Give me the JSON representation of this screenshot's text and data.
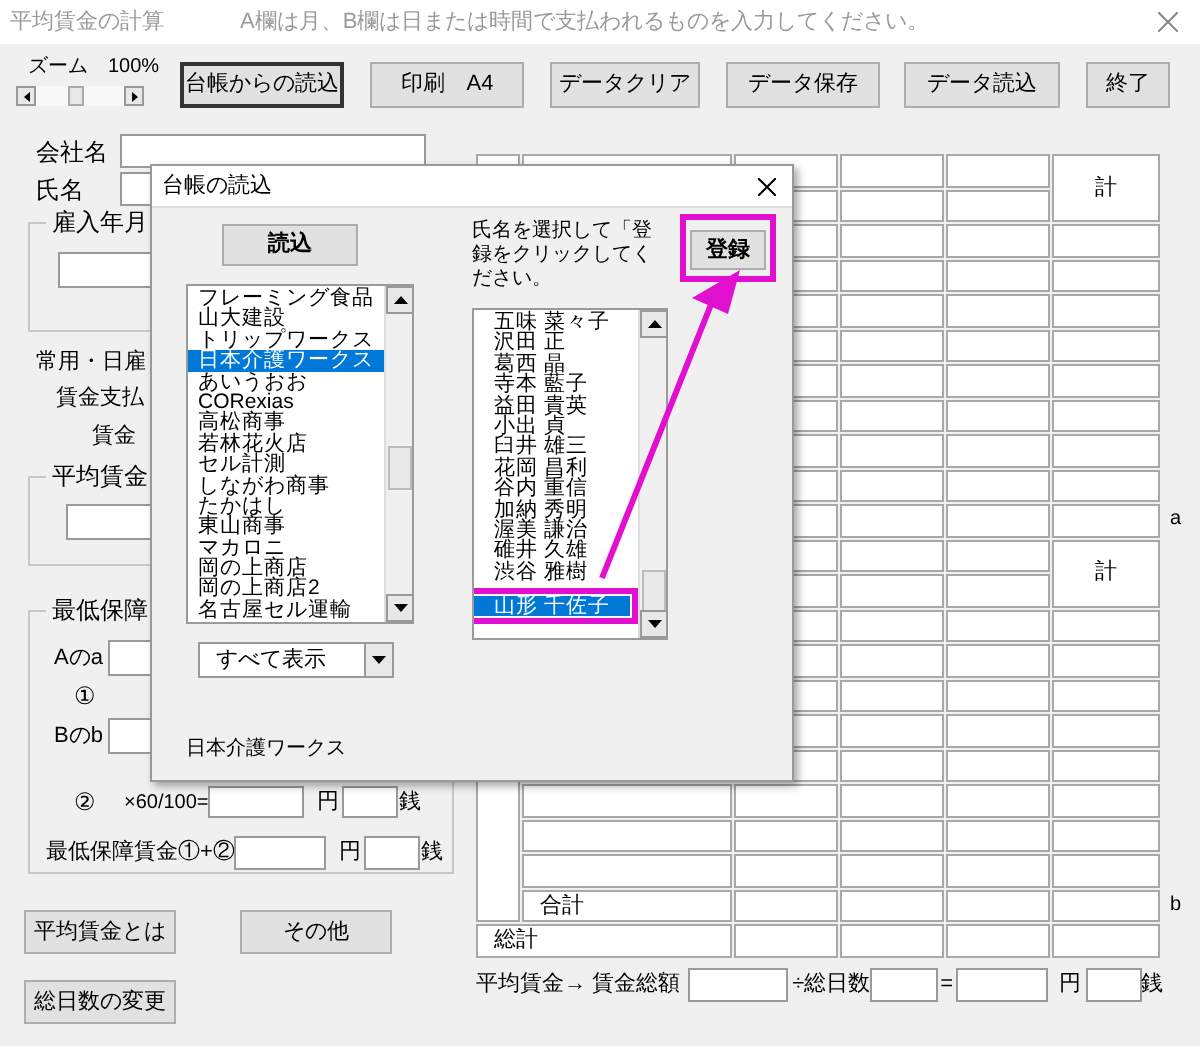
{
  "window": {
    "title": "平均賃金の計算",
    "hint": "A欄は月、B欄は日または時間で支払われるものを入力してください。"
  },
  "zoom": {
    "label": "ズーム",
    "value": "100%",
    "level": 0.45
  },
  "toolbar": [
    {
      "label": "台帳からの読込",
      "focused": true
    },
    {
      "label": "印刷　A4",
      "focused": false
    },
    {
      "label": "データクリア",
      "focused": false
    },
    {
      "label": "データ保存",
      "focused": false
    },
    {
      "label": "データ読込",
      "focused": false
    },
    {
      "label": "終了",
      "focused": false
    }
  ],
  "company": {
    "label": "会社名"
  },
  "name": {
    "label": "氏名"
  },
  "hire_group": {
    "title": "雇入年月"
  },
  "labels": [
    "常用・日雇",
    "賃金支払",
    "賃金"
  ],
  "avg_group": {
    "title": "平均賃金"
  },
  "min_group": {
    "title": "最低保障",
    "a_label": "Aのa",
    "circle1": "①",
    "b_label": "Bのb",
    "circle2": "②",
    "formula": "×60/100=",
    "yen": "円",
    "sen": "銭",
    "total_label": "最低保障賃金①+②",
    "total_yen": "円",
    "total_sen": "銭"
  },
  "buttons": [
    "平均賃金とは",
    "その他",
    "総日数の変更"
  ],
  "wage_table": {
    "section_totals": [
      "計",
      "計"
    ],
    "subtotal": "合計",
    "grand_total": "総計",
    "markers": [
      "a",
      "b"
    ]
  },
  "footer": {
    "label": "平均賃金→ 賃金総額",
    "divide": "÷総日数",
    "equals": "=",
    "yen": "円",
    "sen": "銭"
  },
  "dialog": {
    "title": "台帳の読込",
    "load_button": "読込",
    "instruction": "氏名を選択して「登録をクリックしてください。",
    "register_button": "登録",
    "companies": [
      {
        "label": "フレーミング食品",
        "selected": false
      },
      {
        "label": "山大建設",
        "selected": false
      },
      {
        "label": "トリップワークス",
        "selected": false
      },
      {
        "label": "日本介護ワークス",
        "selected": true
      },
      {
        "label": "あいうおお",
        "selected": false
      },
      {
        "label": "CORexias",
        "selected": false
      },
      {
        "label": "高松商事",
        "selected": false
      },
      {
        "label": "若林花火店",
        "selected": false
      },
      {
        "label": "セル計測",
        "selected": false
      },
      {
        "label": "しながわ商事",
        "selected": false
      },
      {
        "label": "たかはし",
        "selected": false
      },
      {
        "label": "東山商事",
        "selected": false
      },
      {
        "label": "マカロニ",
        "selected": false
      },
      {
        "label": "岡の上商店",
        "selected": false
      },
      {
        "label": "岡の上商店2",
        "selected": false
      },
      {
        "label": "名古屋セル運輸",
        "selected": false
      }
    ],
    "employees": [
      {
        "label": "五味 菜々子",
        "selected": false
      },
      {
        "label": "沢田 正",
        "selected": false
      },
      {
        "label": "葛西 晶",
        "selected": false
      },
      {
        "label": "寺本 藍子",
        "selected": false
      },
      {
        "label": "益田 貴英",
        "selected": false
      },
      {
        "label": "小出 貞",
        "selected": false
      },
      {
        "label": "臼井 雄三",
        "selected": false
      },
      {
        "label": "花岡 昌利",
        "selected": false
      },
      {
        "label": "谷内 重信",
        "selected": false
      },
      {
        "label": "加納 秀明",
        "selected": false
      },
      {
        "label": "渥美 謙治",
        "selected": false
      },
      {
        "label": "碓井 久雄",
        "selected": false
      },
      {
        "label": "渋谷 雅樹",
        "selected": false
      },
      {
        "label": "山形 千佐子",
        "selected": true
      }
    ],
    "filter": "すべて表示",
    "current_company": "日本介護ワークス"
  }
}
